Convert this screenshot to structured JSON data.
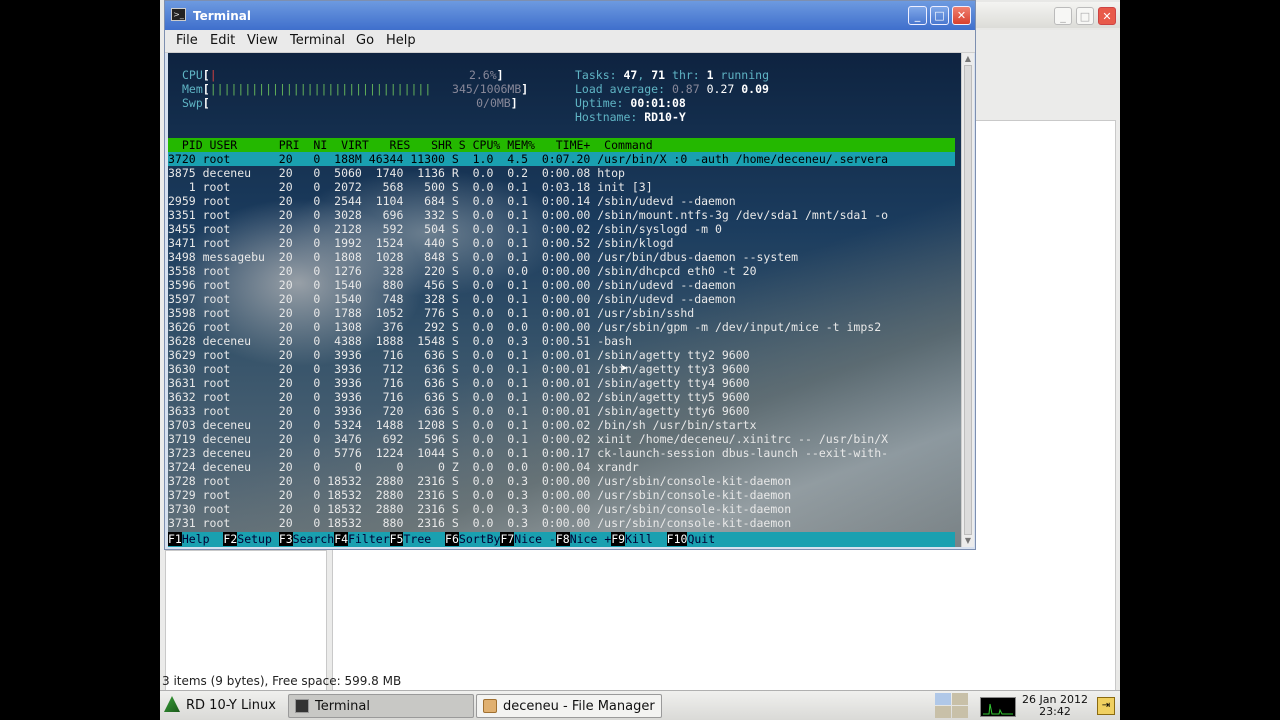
{
  "terminal_window": {
    "title": "Terminal",
    "menu": [
      "File",
      "Edit",
      "View",
      "Terminal",
      "Go",
      "Help"
    ],
    "window_buttons": [
      "_",
      "□",
      "✕"
    ]
  },
  "htop": {
    "meters": [
      {
        "label": "CPU",
        "bar": "|",
        "value": "2.6%"
      },
      {
        "label": "Mem",
        "bar": "||||||||||||||||||||||||||||||||",
        "value": "345/1006MB"
      },
      {
        "label": "Swp",
        "bar": "",
        "value": "0/0MB"
      }
    ],
    "tasks_label": "Tasks:",
    "tasks": "47",
    "tasks_sep": ",",
    "threads": "71",
    "thr_label": "thr:",
    "running": "1",
    "running_label": "running",
    "load_label": "Load average:",
    "load1": "0.87",
    "load5": "0.27",
    "load15": "0.09",
    "uptime_label": "Uptime:",
    "uptime": "00:01:08",
    "hostname_label": "Hostname:",
    "hostname": "RD10-Y",
    "columns": "  PID USER      PRI  NI  VIRT   RES   SHR S CPU% MEM%   TIME+  Command",
    "processes": [
      "3720 root       20   0  188M 46344 11300 S  1.0  4.5  0:07.20 /usr/bin/X :0 -auth /home/deceneu/.servera",
      "3875 deceneu    20   0  5060  1740  1136 R  0.0  0.2  0:00.08 htop",
      "   1 root       20   0  2072   568   500 S  0.0  0.1  0:03.18 init [3]",
      "2959 root       20   0  2544  1104   684 S  0.0  0.1  0:00.14 /sbin/udevd --daemon",
      "3351 root       20   0  3028   696   332 S  0.0  0.1  0:00.00 /sbin/mount.ntfs-3g /dev/sda1 /mnt/sda1 -o",
      "3455 root       20   0  2128   592   504 S  0.0  0.1  0:00.02 /sbin/syslogd -m 0",
      "3471 root       20   0  1992  1524   440 S  0.0  0.1  0:00.52 /sbin/klogd",
      "3498 messagebu  20   0  1808  1028   848 S  0.0  0.1  0:00.00 /usr/bin/dbus-daemon --system",
      "3558 root       20   0  1276   328   220 S  0.0  0.0  0:00.00 /sbin/dhcpcd eth0 -t 20",
      "3596 root       20   0  1540   880   456 S  0.0  0.1  0:00.00 /sbin/udevd --daemon",
      "3597 root       20   0  1540   748   328 S  0.0  0.1  0:00.00 /sbin/udevd --daemon",
      "3598 root       20   0  1788  1052   776 S  0.0  0.1  0:00.01 /usr/sbin/sshd",
      "3626 root       20   0  1308   376   292 S  0.0  0.0  0:00.00 /usr/sbin/gpm -m /dev/input/mice -t imps2",
      "3628 deceneu    20   0  4388  1888  1548 S  0.0  0.3  0:00.51 -bash",
      "3629 root       20   0  3936   716   636 S  0.0  0.1  0:00.01 /sbin/agetty tty2 9600",
      "3630 root       20   0  3936   712   636 S  0.0  0.1  0:00.01 /sbin/agetty tty3 9600",
      "3631 root       20   0  3936   716   636 S  0.0  0.1  0:00.01 /sbin/agetty tty4 9600",
      "3632 root       20   0  3936   716   636 S  0.0  0.1  0:00.02 /sbin/agetty tty5 9600",
      "3633 root       20   0  3936   720   636 S  0.0  0.1  0:00.01 /sbin/agetty tty6 9600",
      "3703 deceneu    20   0  5324  1488  1208 S  0.0  0.1  0:00.02 /bin/sh /usr/bin/startx",
      "3719 deceneu    20   0  3476   692   596 S  0.0  0.1  0:00.02 xinit /home/deceneu/.xinitrc -- /usr/bin/X",
      "3723 deceneu    20   0  5776  1224  1044 S  0.0  0.1  0:00.17 ck-launch-session dbus-launch --exit-with-",
      "3724 deceneu    20   0     0     0     0 Z  0.0  0.0  0:00.04 xrandr",
      "3728 root       20   0 18532  2880  2316 S  0.0  0.3  0:00.00 /usr/sbin/console-kit-daemon",
      "3729 root       20   0 18532  2880  2316 S  0.0  0.3  0:00.00 /usr/sbin/console-kit-daemon",
      "3730 root       20   0 18532  2880  2316 S  0.0  0.3  0:00.00 /usr/sbin/console-kit-daemon",
      "3731 root       20   0 18532   880  2316 S  0.0  0.3  0:00.00 /usr/sbin/console-kit-daemon"
    ],
    "fkeys": [
      {
        "key": "F1",
        "label": "Help  "
      },
      {
        "key": "F2",
        "label": "Setup "
      },
      {
        "key": "F3",
        "label": "Search"
      },
      {
        "key": "F4",
        "label": "Filter"
      },
      {
        "key": "F5",
        "label": "Tree  "
      },
      {
        "key": "F6",
        "label": "SortBy"
      },
      {
        "key": "F7",
        "label": "Nice -"
      },
      {
        "key": "F8",
        "label": "Nice +"
      },
      {
        "key": "F9",
        "label": "Kill  "
      },
      {
        "key": "F10",
        "label": "Quit"
      }
    ]
  },
  "file_manager": {
    "status": "3 items (9 bytes), Free space: 599.8 MB"
  },
  "taskbar": {
    "start_label": "RD 10-Y Linux",
    "tasks": [
      {
        "label": "Terminal",
        "active": true
      },
      {
        "label": "deceneu - File Manager",
        "active": false
      }
    ],
    "clock_date": "26 Jan 2012",
    "clock_time": "23:42"
  },
  "colors": {
    "column_header_bg": "#24b800",
    "selection_bg": "#1aa0b0",
    "title_bar": "#3f6fcc"
  }
}
